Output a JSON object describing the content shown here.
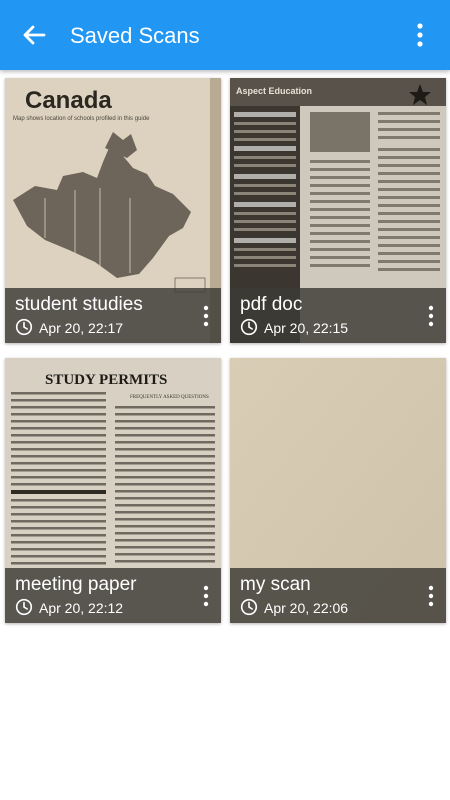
{
  "appbar": {
    "title": "Saved Scans",
    "back_icon": "arrow-back-icon",
    "menu_icon": "more-vert-icon",
    "color": "#2196f3"
  },
  "scans": [
    {
      "name": "student studies",
      "date": "Apr 20, 22:17",
      "thumbnail_text": {
        "heading": "Canada",
        "caption": "Map shows location of schools profiled in this guide"
      }
    },
    {
      "name": "pdf doc",
      "date": "Apr 20, 22:15",
      "thumbnail_text": {
        "heading": "Aspect Education"
      }
    },
    {
      "name": "meeting paper",
      "date": "Apr 20, 22:12",
      "thumbnail_text": {
        "heading": "STUDY PERMITS",
        "subheading": "FREQUENTLY ASKED QUESTIONS"
      }
    },
    {
      "name": "my scan",
      "date": "Apr 20, 22:06",
      "thumbnail_text": {}
    }
  ],
  "card_icons": {
    "clock": "clock-icon",
    "more": "more-vert-icon"
  }
}
